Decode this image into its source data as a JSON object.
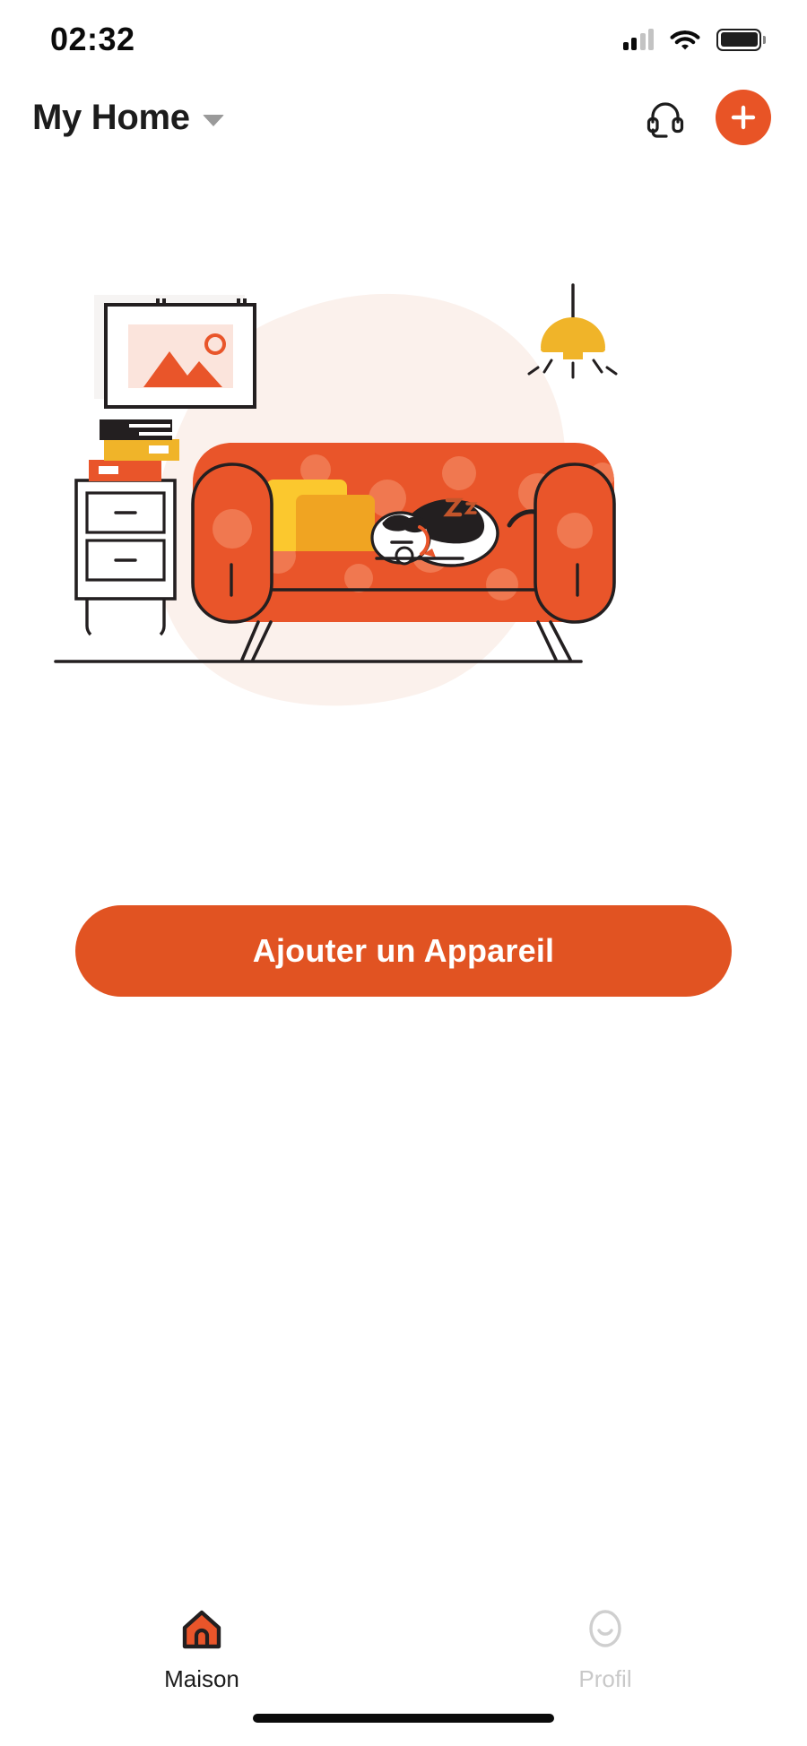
{
  "status_bar": {
    "time": "02:32",
    "signal_icon": "cellular-signal-icon",
    "signal_bars_active": 2,
    "signal_bars_total": 4,
    "wifi_icon": "wifi-icon",
    "battery_icon": "battery-full-icon"
  },
  "header": {
    "home_name": "My Home",
    "caret_icon": "chevron-down-icon",
    "support_icon": "headset-support-icon",
    "add_icon": "plus-icon"
  },
  "illustration": {
    "name": "empty-living-room-illustration",
    "elements": [
      "wall-picture-frame",
      "mountain-photo",
      "nightstand",
      "stacked-books",
      "orange-sofa",
      "yellow-pillows",
      "sleeping-cat",
      "pendant-lamp"
    ],
    "colors": {
      "sofa": "#E9552A",
      "sofa_dots": "#F07850",
      "pillow_primary": "#FBC82E",
      "pillow_secondary": "#F0A422",
      "lamp": "#F0B429",
      "blob": "#FBF1EC",
      "book_top": "#231F20",
      "book_middle": "#F0B429",
      "book_bottom": "#E9552A",
      "frame_photo_bg": "#FBE4DC",
      "outline": "#231F20"
    }
  },
  "cta": {
    "label": "Ajouter un Appareil",
    "color": "#E15322"
  },
  "bottom_nav": {
    "items": [
      {
        "label": "Maison",
        "icon": "home-icon",
        "active": true
      },
      {
        "label": "Profil",
        "icon": "profile-face-icon",
        "active": false
      }
    ]
  }
}
